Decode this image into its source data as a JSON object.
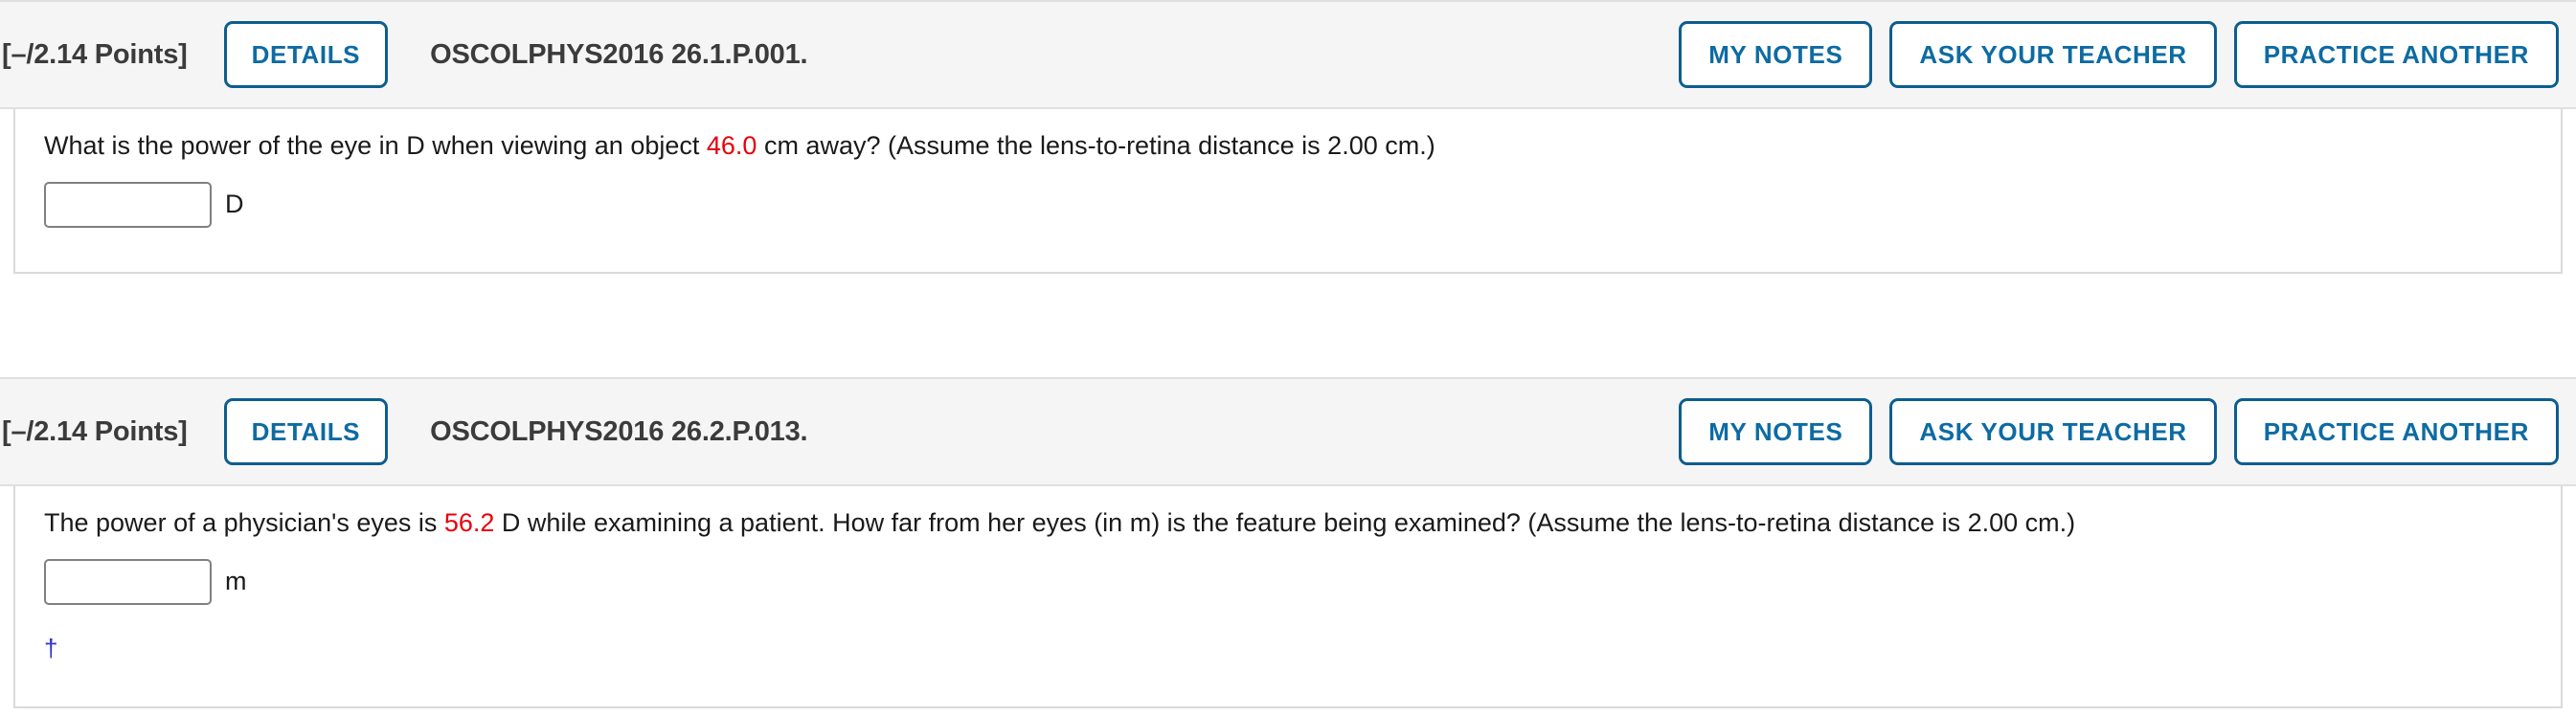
{
  "theme": {
    "accent_blue": "#0d6ba3",
    "border_blue": "#0d5d8f",
    "header_bg": "#f5f5f5",
    "highlight_red": "#e8000b",
    "dagger_blue": "#2b30d6",
    "input_border": "#808080",
    "card_border": "#dadada"
  },
  "questions": [
    {
      "points_label": "[–/2.14 Points]",
      "details_label": "DETAILS",
      "assignment_id": "OSCOLPHYS2016 26.1.P.001.",
      "actions": [
        {
          "label": "MY NOTES",
          "name": "my-notes-button"
        },
        {
          "label": "ASK YOUR TEACHER",
          "name": "ask-your-teacher-button"
        },
        {
          "label": "PRACTICE ANOTHER",
          "name": "practice-another-button"
        }
      ],
      "prompt_before": "What is the power of the eye in D when viewing an object ",
      "prompt_value": "46.0",
      "prompt_after": " cm away? (Assume the lens-to-retina distance is 2.00 cm.)",
      "answer_value": "",
      "answer_placeholder": "",
      "unit": "D",
      "footnote": ""
    },
    {
      "points_label": "[–/2.14 Points]",
      "details_label": "DETAILS",
      "assignment_id": "OSCOLPHYS2016 26.2.P.013.",
      "actions": [
        {
          "label": "MY NOTES",
          "name": "my-notes-button"
        },
        {
          "label": "ASK YOUR TEACHER",
          "name": "ask-your-teacher-button"
        },
        {
          "label": "PRACTICE ANOTHER",
          "name": "practice-another-button"
        }
      ],
      "prompt_before": "The power of a physician's eyes is ",
      "prompt_value": "56.2",
      "prompt_after": " D while examining a patient. How far from her eyes (in m) is the feature being examined? (Assume the lens-to-retina distance is 2.00 cm.)",
      "answer_value": "",
      "answer_placeholder": "",
      "unit": "m",
      "footnote": "†"
    }
  ]
}
